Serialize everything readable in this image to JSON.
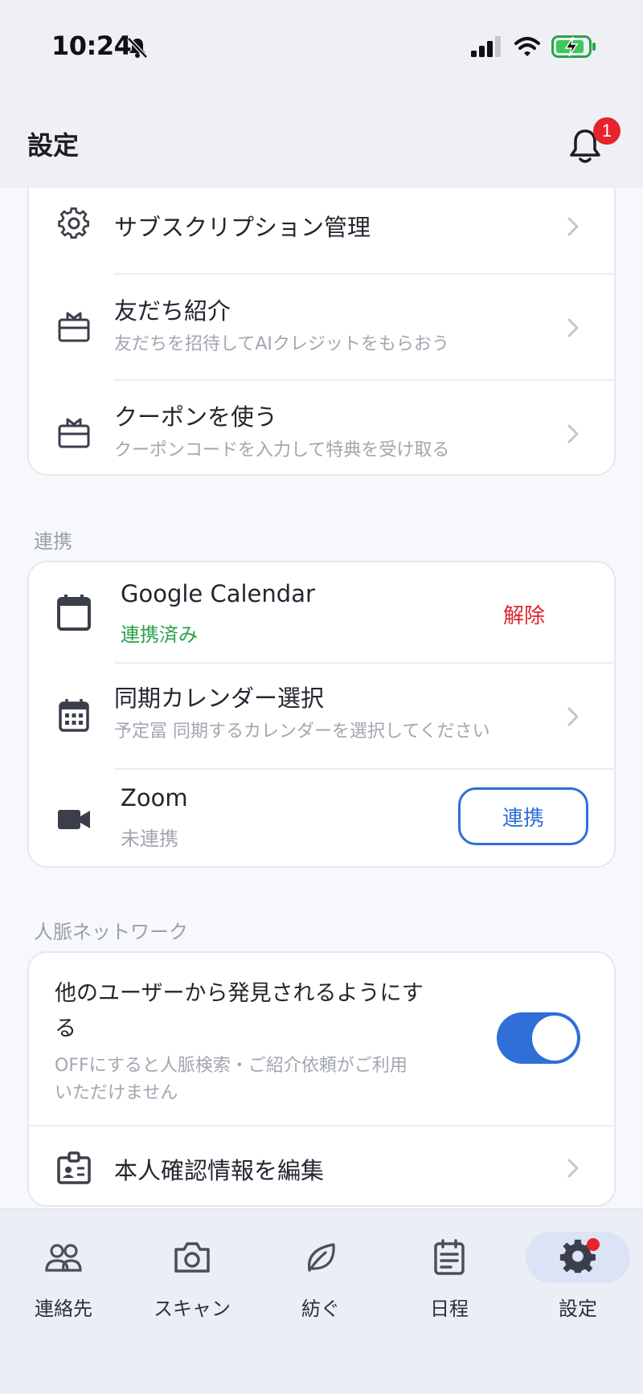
{
  "status_bar": {
    "time": "10:24",
    "icons": [
      "bell-slash-icon",
      "cellular-signal-icon",
      "wifi-icon",
      "battery-charging-icon"
    ]
  },
  "header": {
    "title": "設定",
    "notification_count": "1"
  },
  "account_card": {
    "items": [
      {
        "title": "サブスクリプション管理",
        "icon": "gear-icon"
      },
      {
        "title": "友だち紹介",
        "subtitle": "友だちを招待してAIクレジットをもらおう",
        "icon": "gift-icon"
      },
      {
        "title": "クーポンを使う",
        "subtitle": "クーポンコードを入力して特典を受け取る",
        "icon": "gift-icon"
      }
    ]
  },
  "integrations": {
    "section_label": "連携",
    "google": {
      "title": "Google Calendar",
      "status": "連携済み",
      "action": "解除",
      "status_color": "#2aa14a",
      "action_color": "#d9262d"
    },
    "calendar_select": {
      "title": "同期カレンダー選択",
      "subtitle": "予定冨 同期するカレンダーを選択してください"
    },
    "zoom": {
      "title": "Zoom",
      "status": "未連携",
      "action": "連携"
    }
  },
  "network": {
    "section_label": "人脈ネットワーク",
    "discoverable": {
      "title_line1": "他のユーザーから発見されるようにす",
      "title_line2": "る",
      "desc_line1": "OFFにすると人脈検索・ご紹介依頼がご利用",
      "desc_line2": "いただけません",
      "enabled": true
    },
    "identity": {
      "title": "本人確認情報を編集"
    }
  },
  "tab_bar": {
    "tabs": [
      {
        "label": "連絡先",
        "icon": "contacts-icon"
      },
      {
        "label": "スキャン",
        "icon": "camera-icon"
      },
      {
        "label": "紡ぐ",
        "icon": "leaf-icon"
      },
      {
        "label": "日程",
        "icon": "schedule-icon"
      },
      {
        "label": "設定",
        "icon": "gear-icon",
        "active": true
      }
    ]
  },
  "colors": {
    "accent": "#2f6fd7",
    "danger": "#d9262d",
    "success": "#2aa14a",
    "badge": "#e8232d"
  }
}
